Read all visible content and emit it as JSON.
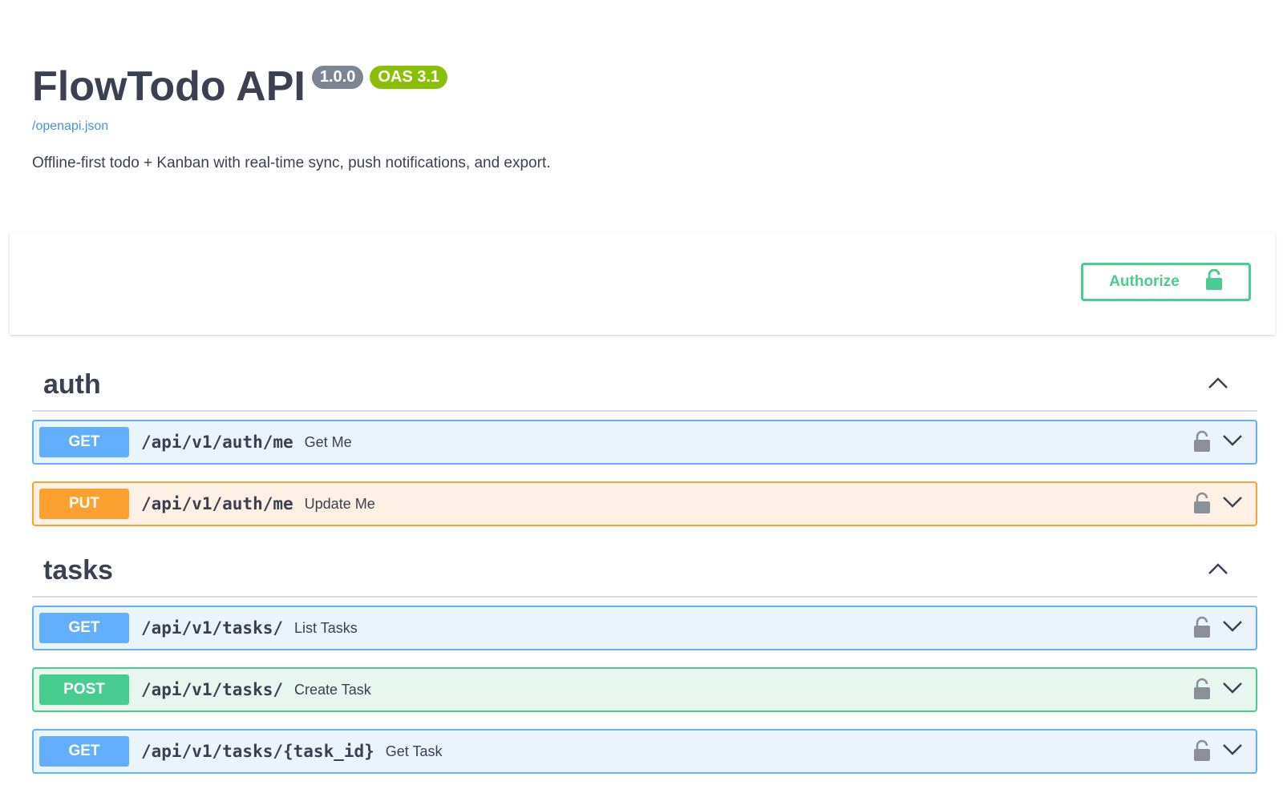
{
  "info": {
    "title": "FlowTodo API",
    "version": "1.0.0",
    "oas": "OAS 3.1",
    "spec_link": "/openapi.json",
    "description": "Offline-first todo + Kanban with real-time sync, push notifications, and export."
  },
  "auth_button": {
    "label": "Authorize",
    "icon": "unlock-icon"
  },
  "colors": {
    "get": "#61affe",
    "put": "#fca130",
    "post": "#49cc90",
    "version_badge": "#7d8492",
    "oas_badge": "#89bf04"
  },
  "tags": [
    {
      "name": "auth",
      "operations": [
        {
          "method": "GET",
          "path": "/api/v1/auth/me",
          "summary": "Get Me"
        },
        {
          "method": "PUT",
          "path": "/api/v1/auth/me",
          "summary": "Update Me"
        }
      ]
    },
    {
      "name": "tasks",
      "operations": [
        {
          "method": "GET",
          "path": "/api/v1/tasks/",
          "summary": "List Tasks"
        },
        {
          "method": "POST",
          "path": "/api/v1/tasks/",
          "summary": "Create Task"
        },
        {
          "method": "GET",
          "path": "/api/v1/tasks/{task_id}",
          "summary": "Get Task"
        }
      ]
    }
  ]
}
